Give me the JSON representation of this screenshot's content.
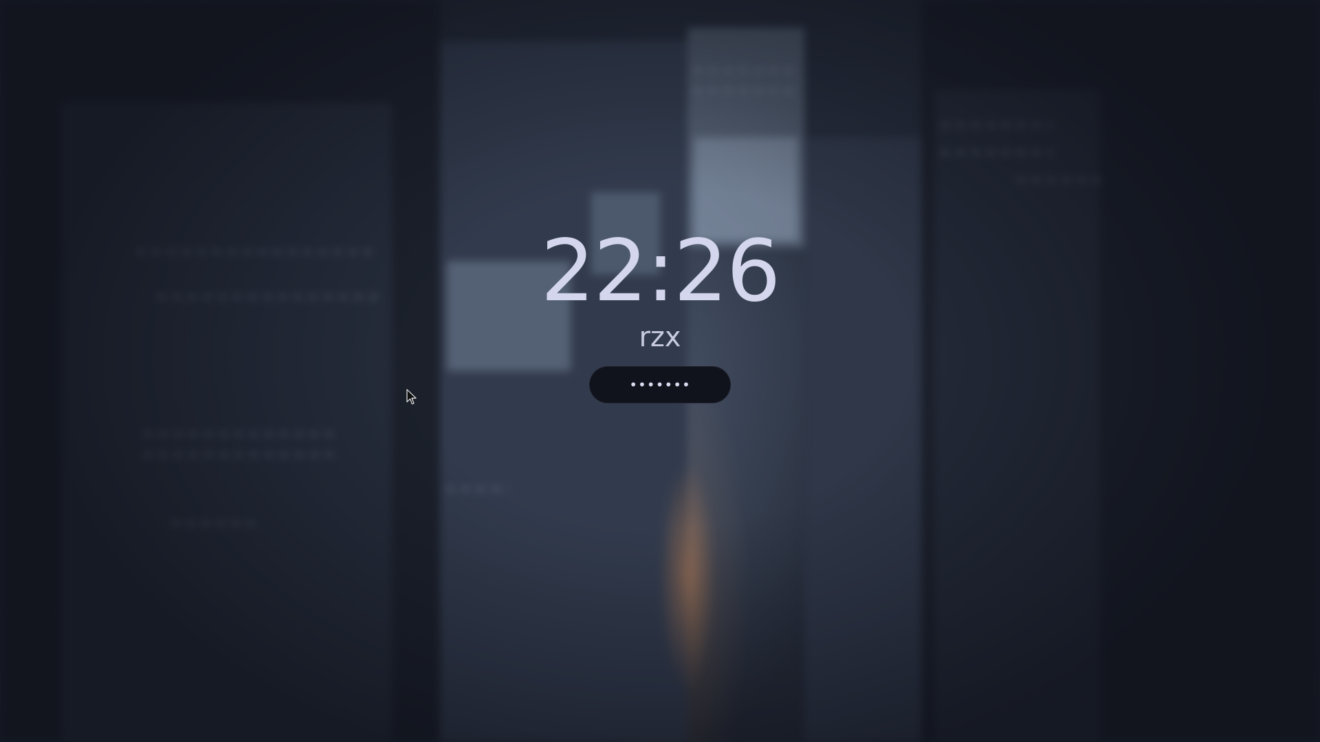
{
  "lock_screen": {
    "time": "22:26",
    "username": "rzx",
    "password_masked": "•••••••"
  },
  "icons": {
    "pointer": "mouse-pointer-icon"
  },
  "colors": {
    "clock_text": "#d3d6ec",
    "field_background": "#11131c"
  }
}
